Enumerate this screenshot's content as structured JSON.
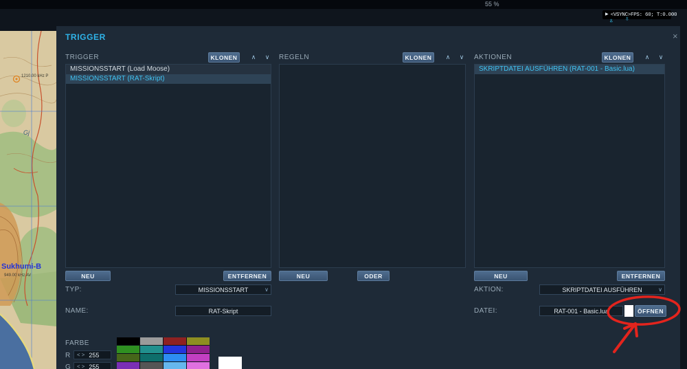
{
  "topbar": {
    "partial_text": "55 %"
  },
  "hud": {
    "play_icon": "▶",
    "fps_text": "<VSYNC>FPS: 60; T:0.000",
    "weather_icon_left": "♆",
    "weather_icon_right": "♁"
  },
  "map": {
    "labels": {
      "freq1": "1210.00 kHz P",
      "place_small": "Gj",
      "city": "Sukhumi-B",
      "freq2": "949.00 kHz AV"
    }
  },
  "panel": {
    "title": "TRIGGER",
    "close_icon": "×",
    "icons": {
      "chevron_up": "∧",
      "chevron_down": "∨",
      "stepper_left": "<",
      "stepper_right": ">"
    },
    "columns": [
      {
        "header": "TRIGGER",
        "clone_label": "KLONEN",
        "items": [
          {
            "label": "MISSIONSSTART (Load Moose)"
          },
          {
            "label": "MISSIONSSTART (RAT-Skript)"
          }
        ],
        "buttons": {
          "new": "NEU",
          "secondary": "ENTFERNEN"
        }
      },
      {
        "header": "REGELN",
        "clone_label": "KLONEN",
        "items": [],
        "buttons": {
          "new": "NEU",
          "secondary": "ODER"
        }
      },
      {
        "header": "AKTIONEN",
        "clone_label": "KLONEN",
        "items": [
          {
            "label": "SKRIPTDATEI AUSFÜHREN (RAT-001 - Basic.lua)"
          }
        ],
        "buttons": {
          "new": "NEU",
          "secondary": "ENTFERNEN"
        }
      }
    ],
    "fields": {
      "typ_label": "TYP:",
      "typ_value": "MISSIONSSTART",
      "name_label": "NAME:",
      "name_value": "RAT-Skript",
      "aktion_label": "AKTION:",
      "aktion_value": "SKRIPTDATEI AUSFÜHREN",
      "datei_label": "DATEI:",
      "datei_value": "RAT-001 - Basic.lua",
      "open_label": "ÖFFNEN"
    },
    "farbe": {
      "label": "FARBE",
      "r_label": "R",
      "r_value": "255",
      "g_label": "G",
      "g_value": "255",
      "palette": [
        [
          "#000000",
          "#9b9b9b",
          "#8e2121",
          "#8e8e21"
        ],
        [
          "#2f9021",
          "#21908e",
          "#2335dd",
          "#90218e"
        ],
        [
          "#46661a",
          "#0e6e6b",
          "#2d8df2",
          "#c23fc2"
        ],
        [
          "#7a2fb5",
          "#555555",
          "#66b7ee",
          "#e070e0"
        ]
      ]
    }
  },
  "annotation_color": "#e3241d"
}
